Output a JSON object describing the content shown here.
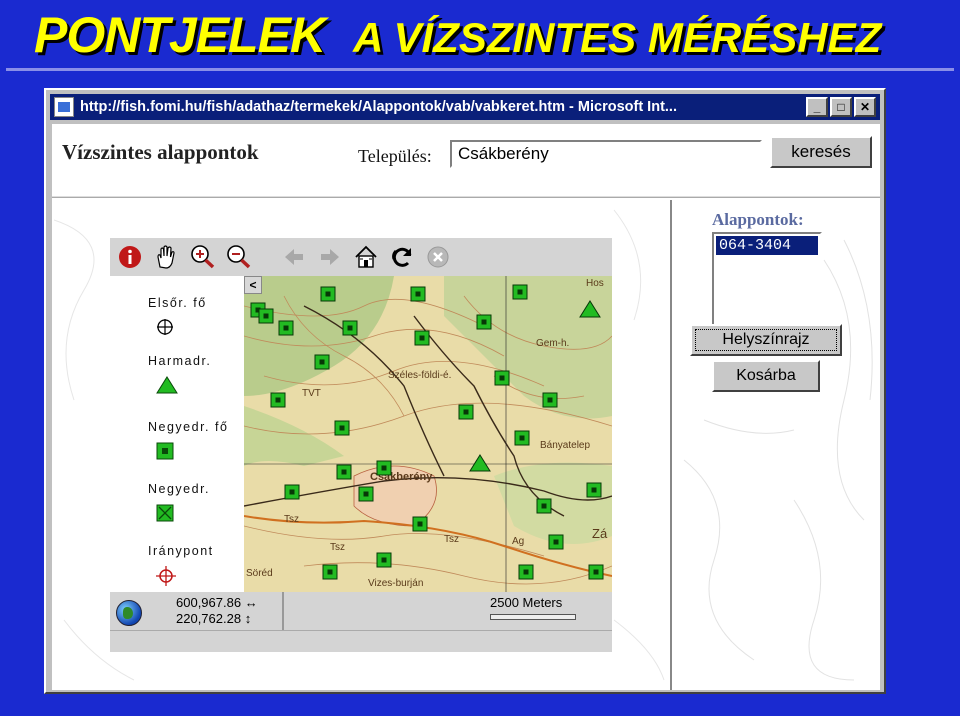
{
  "slide": {
    "title_part1": "PONTJELEK",
    "title_part2": "A VÍZSZINTES MÉRÉSHEZ"
  },
  "browser": {
    "title": "http://fish.fomi.hu/fish/adathaz/termekek/Alappontok/vab/vabkeret.htm - Microsoft Int...",
    "buttons": {
      "minimize": "_",
      "maximize": "□",
      "close": "✕"
    }
  },
  "page": {
    "heading": "Vízszintes alappontok",
    "settlement_label": "Település:",
    "settlement_value": "Csákberény",
    "search_button": "keresés"
  },
  "toolbar": {
    "tools": [
      "info-icon",
      "pan-hand-icon",
      "zoom-in-icon",
      "zoom-out-icon",
      "back-arrow-icon",
      "forward-arrow-icon",
      "home-icon",
      "refresh-icon",
      "stop-icon"
    ]
  },
  "legend": {
    "items": [
      {
        "label": "Elsőr. fő",
        "symbol": "circle-cross-icon"
      },
      {
        "label": "Harmadr.",
        "symbol": "green-triangle-icon"
      },
      {
        "label": "Negyedr. fő",
        "symbol": "green-square-icon"
      },
      {
        "label": "Negyedr.",
        "symbol": "green-square-cross-icon"
      },
      {
        "label": "Iránypont",
        "symbol": "red-target-icon"
      }
    ]
  },
  "map": {
    "collapse": "<",
    "place_names": [
      "Széles-földi-é.",
      "TVT",
      "Gem-h.",
      "Csákberény",
      "Bányatelep",
      "Tsz",
      "Tsz",
      "Ag",
      "Zá",
      "Söréd",
      "Vizes-burján",
      "Hos",
      "Tsz"
    ]
  },
  "status": {
    "x_coord": "600,967.86",
    "y_coord": "220,762.28",
    "scale_label": "2500 Meters"
  },
  "panel": {
    "heading": "Alappontok:",
    "selected": "064-3404",
    "site_button": "Helyszínrajz",
    "cart_button": "Kosárba"
  },
  "colors": {
    "slide_bg": "#1a2ad0",
    "title": "#ffff00",
    "titlebar": "#0a1f7a",
    "marker": "#22bb22"
  }
}
